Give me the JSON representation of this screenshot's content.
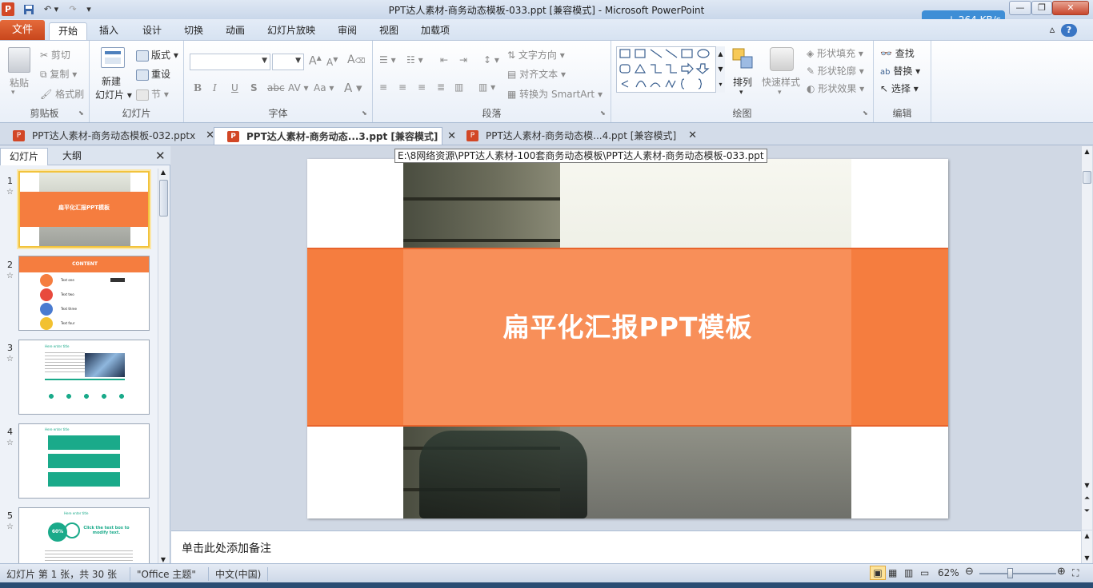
{
  "window": {
    "title": "PPT达人素材-商务动态模板-033.ppt [兼容模式]  -  Microsoft PowerPoint",
    "app_icon": "P",
    "net_speed": "264 KB/s"
  },
  "ribbon_tabs": [
    "文件",
    "开始",
    "插入",
    "设计",
    "切换",
    "动画",
    "幻灯片放映",
    "审阅",
    "视图",
    "加载项"
  ],
  "ribbon": {
    "clipboard": {
      "paste": "粘贴",
      "cut": "剪切",
      "copy": "复制",
      "format_painter": "格式刷",
      "label": "剪贴板"
    },
    "slides": {
      "new_slide": "新建",
      "new_slide2": "幻灯片",
      "layout": "版式",
      "reset": "重设",
      "section": "节",
      "label": "幻灯片"
    },
    "font": {
      "bold": "B",
      "italic": "I",
      "underline": "U",
      "shadow": "S",
      "strike": "abc",
      "spacing": "AV",
      "case": "Aa",
      "label": "字体"
    },
    "paragraph": {
      "text_direction": "文字方向",
      "align_text": "对齐文本",
      "smartart": "转换为 SmartArt",
      "label": "段落"
    },
    "drawing": {
      "arrange": "排列",
      "quick_styles": "快速样式",
      "shape_fill": "形状填充",
      "shape_outline": "形状轮廓",
      "shape_effects": "形状效果",
      "label": "绘图"
    },
    "editing": {
      "find": "查找",
      "replace": "替换",
      "select": "选择",
      "label": "编辑"
    }
  },
  "doc_tabs": [
    {
      "label": "PPT达人素材-商务动态模板-032.pptx"
    },
    {
      "label": "PPT达人素材-商务动态...3.ppt [兼容模式]"
    },
    {
      "label": "PPT达人素材-商务动态模...4.ppt [兼容模式]"
    }
  ],
  "tooltip": "E:\\8网络资源\\PPT达人素材-100套商务动态模板\\PPT达人素材-商务动态模板-033.ppt",
  "left_pane": {
    "tab_slides": "幻灯片",
    "tab_outline": "大纲",
    "close": "✕",
    "thumbnails": [
      {
        "num": "1",
        "title": "扁平化汇报PPT模板"
      },
      {
        "num": "2",
        "title": "CONTENT",
        "items": [
          "Text one",
          "Text two",
          "Text three",
          "Text four"
        ]
      },
      {
        "num": "3",
        "title": "Here enter title"
      },
      {
        "num": "4",
        "title": "Here enter title"
      },
      {
        "num": "5",
        "title": "Here enter title",
        "percent": "60%",
        "side": "Click the text box to modify text."
      }
    ]
  },
  "slide": {
    "title": "扁平化汇报PPT模板"
  },
  "notes_placeholder": "单击此处添加备注",
  "status": {
    "slide_info": "幻灯片 第 1 张，共 30 张",
    "theme": "\"Office 主题\"",
    "language": "中文(中国)",
    "zoom": "62%",
    "zoom_fraction": 0.4
  },
  "colors": {
    "accent_orange": "#f57d3f",
    "file_tab": "#c8461c"
  }
}
